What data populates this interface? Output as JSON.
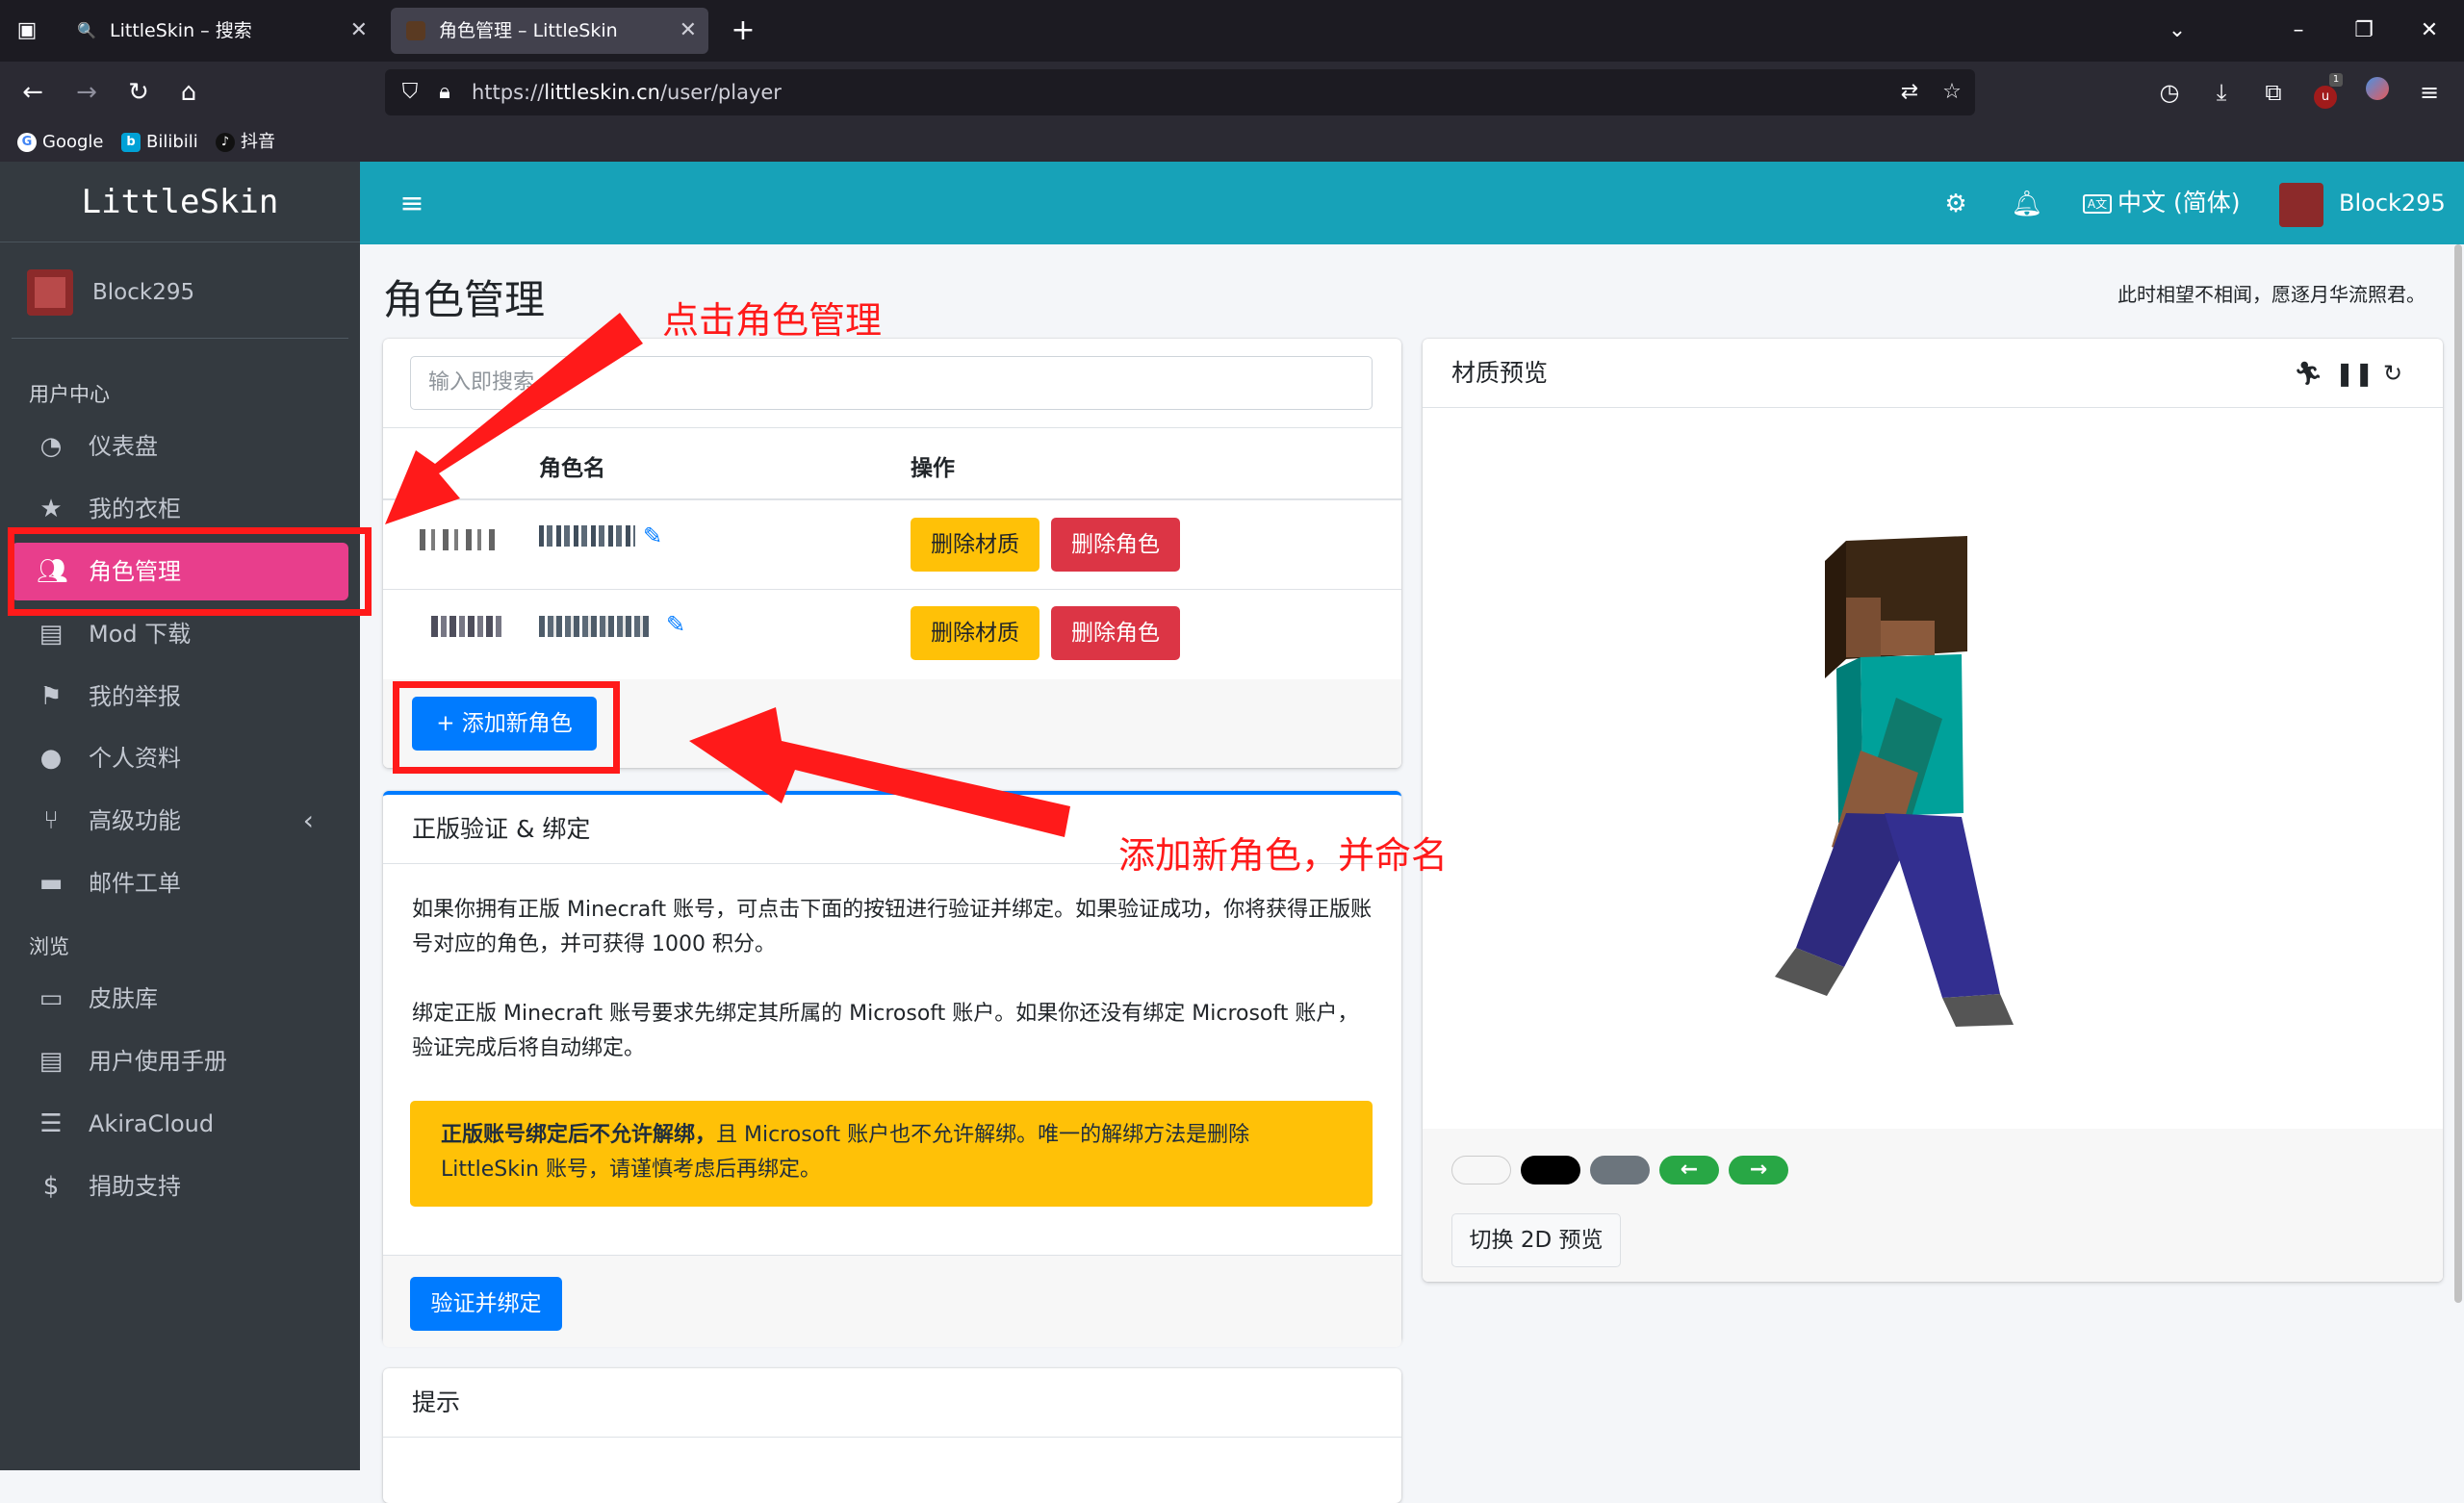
{
  "browser": {
    "tabs": [
      {
        "title": "LittleSkin – 搜索"
      },
      {
        "title": "角色管理 – LittleSkin"
      }
    ],
    "url_prefix": "https://",
    "url_domain": "littleskin.cn",
    "url_path": "/user/player",
    "bookmarks": [
      "Google",
      "Bilibili",
      "抖音"
    ],
    "extension_badge": "1"
  },
  "sidebar": {
    "brand": "LittleSkin",
    "username": "Block295",
    "section_user": "用户中心",
    "section_browse": "浏览",
    "items": [
      {
        "label": "仪表盘",
        "icon": "dashboard-icon"
      },
      {
        "label": "我的衣柜",
        "icon": "star-icon"
      },
      {
        "label": "角色管理",
        "icon": "users-icon"
      },
      {
        "label": "Mod 下载",
        "icon": "book-icon"
      },
      {
        "label": "我的举报",
        "icon": "flag-icon"
      },
      {
        "label": "个人资料",
        "icon": "user-icon"
      },
      {
        "label": "高级功能",
        "icon": "branch-icon"
      },
      {
        "label": "邮件工单",
        "icon": "ticket-icon"
      },
      {
        "label": "皮肤库",
        "icon": "archive-icon"
      },
      {
        "label": "用户使用手册",
        "icon": "book-icon"
      },
      {
        "label": "AkiraCloud",
        "icon": "server-icon"
      },
      {
        "label": "捐助支持",
        "icon": "donate-icon"
      }
    ]
  },
  "header": {
    "language": "中文 (简体)",
    "username": "Block295"
  },
  "main": {
    "title": "角色管理",
    "motto": "此时相望不相闻，愿逐月华流照君。",
    "search_placeholder": "输入即搜索",
    "table": {
      "col_name": "角色名",
      "col_ops": "操作",
      "remove_texture": "删除材质",
      "delete_player": "删除角色"
    },
    "add_player": "添加新角色",
    "verify_card": {
      "title": "正版验证 & 绑定",
      "p1": "如果你拥有正版 Minecraft 账号，可点击下面的按钮进行验证并绑定。如果验证成功，你将获得正版账号对应的角色，并可获得 1000 积分。",
      "p2": "绑定正版 Minecraft 账号要求先绑定其所属的 Microsoft 账户。如果你还没有绑定 Microsoft 账户，验证完成后将自动绑定。",
      "alert_bold": "正版账号绑定后不允许解绑，",
      "alert_rest": "且 Microsoft 账户也不允许解绑。唯一的解绑方法是删除 LittleSkin 账号，请谨慎考虑后再绑定。",
      "button": "验证并绑定"
    },
    "tips_card": {
      "title": "提示"
    },
    "preview_card": {
      "title": "材质预览",
      "toggle_2d": "切换 2D 预览",
      "bg_colors": [
        "#ffffff",
        "#000000",
        "#6c757d"
      ]
    }
  },
  "annotations": {
    "a1": "点击角色管理",
    "a2": "添加新角色，并命名"
  }
}
